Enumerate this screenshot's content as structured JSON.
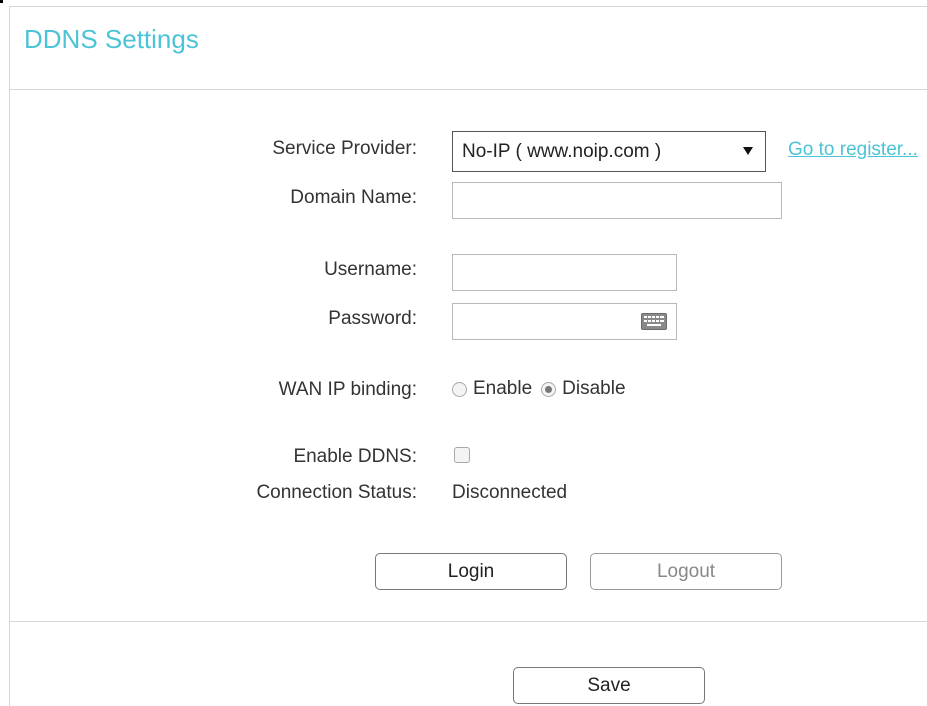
{
  "page": {
    "title": "DDNS Settings"
  },
  "form": {
    "service_provider": {
      "label": "Service Provider:",
      "selected": "No-IP ( www.noip.com )",
      "register_link": "Go to register..."
    },
    "domain_name": {
      "label": "Domain Name:",
      "value": ""
    },
    "username": {
      "label": "Username:",
      "value": ""
    },
    "password": {
      "label": "Password:",
      "value": ""
    },
    "wan_ip_binding": {
      "label": "WAN IP binding:",
      "options": [
        "Enable",
        "Disable"
      ],
      "selected": "Disable"
    },
    "enable_ddns": {
      "label": "Enable DDNS:",
      "checked": false
    },
    "connection_status": {
      "label": "Connection Status:",
      "value": "Disconnected"
    }
  },
  "buttons": {
    "login": "Login",
    "logout": "Logout",
    "save": "Save"
  },
  "colors": {
    "accent": "#4cc3d6",
    "divider": "#d6d6d6"
  }
}
